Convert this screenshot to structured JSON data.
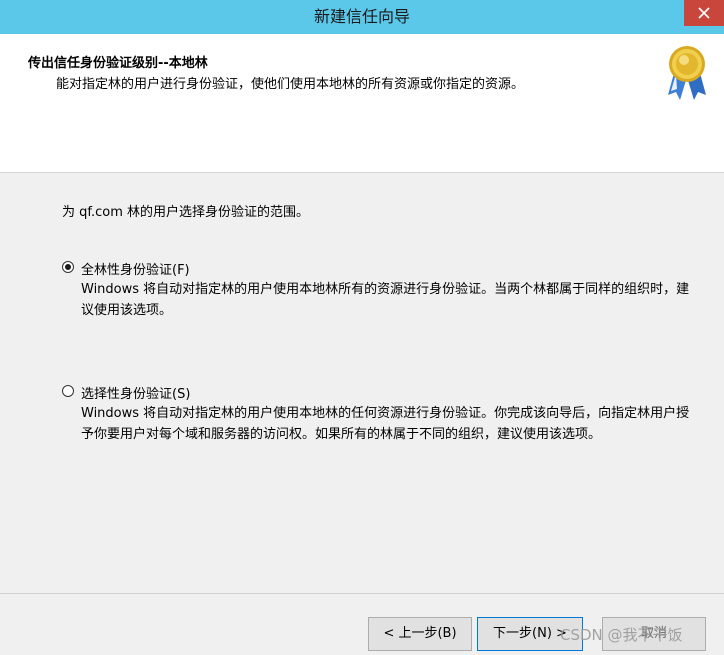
{
  "window": {
    "title": "新建信任向导"
  },
  "header": {
    "title": "传出信任身份验证级别--本地林",
    "description": "能对指定林的用户进行身份验证，使他们使用本地林的所有资源或你指定的资源。",
    "icon": "certificate-badge-icon"
  },
  "content": {
    "prompt": "为 qf.com 林的用户选择身份验证的范围。",
    "options": [
      {
        "label": "全林性身份验证(F)",
        "description": "Windows 将自动对指定林的用户使用本地林所有的资源进行身份验证。当两个林都属于同样的组织时，建议使用该选项。",
        "selected": true
      },
      {
        "label": "选择性身份验证(S)",
        "description": "Windows 将自动对指定林的用户使用本地林的任何资源进行身份验证。你完成该向导后，向指定林用户授予你要用户对每个域和服务器的访问权。如果所有的林属于不同的组织，建议使用该选项。",
        "selected": false
      }
    ]
  },
  "footer": {
    "back_label": "< 上一步(B)",
    "next_label": "下一步(N) >",
    "cancel_label": "取消"
  },
  "watermark": "CSDN @我不干饭",
  "colors": {
    "titlebar": "#5bc8ea",
    "close": "#c9463d",
    "focus": "#0078d7"
  }
}
